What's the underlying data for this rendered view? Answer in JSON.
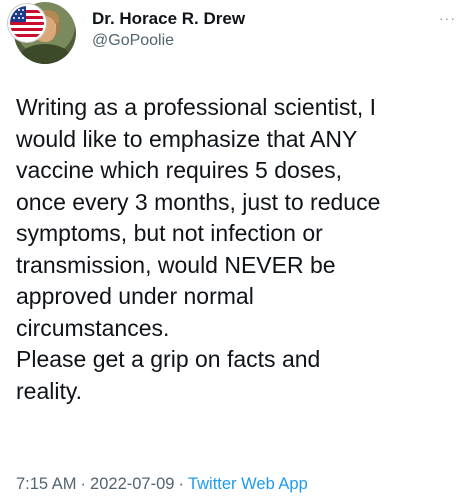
{
  "author": {
    "name": "Dr. Horace R. Drew",
    "handle": "@GoPoolie"
  },
  "header": {
    "more_icon": "more-horizontal-icon"
  },
  "tweet": {
    "lines": [
      "Writing as a professional scientist, I",
      "would like to emphasize that ANY",
      "vaccine which requires 5 doses,",
      "once every 3 months, just to reduce",
      "symptoms, but not infection or",
      "transmission, would NEVER be",
      "approved under normal",
      "circumstances.",
      "Please get a grip on facts and",
      "reality."
    ]
  },
  "meta": {
    "time": "7:15 AM",
    "separator": "·",
    "date": "2022-07-09",
    "source": "Twitter Web App"
  },
  "colors": {
    "text": "#0f1419",
    "secondary": "#536471",
    "link": "#1d9bf0"
  }
}
